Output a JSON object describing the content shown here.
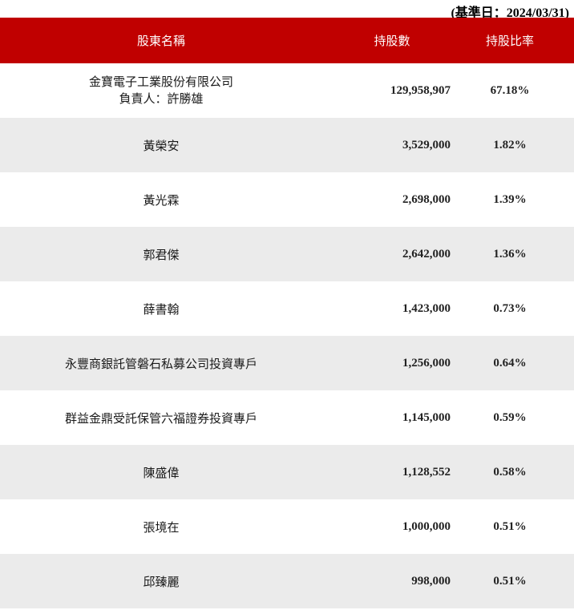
{
  "base_date_note": "(基準日：2024/03/31)",
  "table": {
    "headers": {
      "name": "股東名稱",
      "shares": "持股數",
      "ratio": "持股比率"
    },
    "rows": [
      {
        "name": "金寶電子工業股份有限公司",
        "name_line2": "負責人：許勝雄",
        "shares": "129,958,907",
        "ratio": "67.18%"
      },
      {
        "name": "黃榮安",
        "shares": "3,529,000",
        "ratio": "1.82%"
      },
      {
        "name": "黃光霖",
        "shares": "2,698,000",
        "ratio": "1.39%"
      },
      {
        "name": "郭君傑",
        "shares": "2,642,000",
        "ratio": "1.36%"
      },
      {
        "name": "薛書翰",
        "shares": "1,423,000",
        "ratio": "0.73%"
      },
      {
        "name": "永豐商銀託管磐石私募公司投資專戶",
        "shares": "1,256,000",
        "ratio": "0.64%"
      },
      {
        "name": "群益金鼎受託保管六福證券投資專戶",
        "shares": "1,145,000",
        "ratio": "0.59%"
      },
      {
        "name": "陳盛偉",
        "shares": "1,128,552",
        "ratio": "0.58%"
      },
      {
        "name": "張境在",
        "shares": "1,000,000",
        "ratio": "0.51%"
      },
      {
        "name": "邱臻麗",
        "shares": "998,000",
        "ratio": "0.51%"
      }
    ]
  }
}
